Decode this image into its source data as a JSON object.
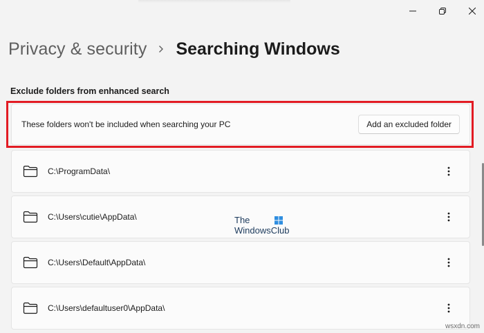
{
  "breadcrumb": {
    "parent": "Privacy & security",
    "current": "Searching Windows"
  },
  "section": {
    "heading": "Exclude folders from enhanced search"
  },
  "header_card": {
    "description": "These folders won't be included when searching your PC",
    "add_button": "Add an excluded folder"
  },
  "folders": [
    {
      "path": "C:\\ProgramData\\"
    },
    {
      "path": "C:\\Users\\cutie\\AppData\\"
    },
    {
      "path": "C:\\Users\\Default\\AppData\\"
    },
    {
      "path": "C:\\Users\\defaultuser0\\AppData\\"
    }
  ],
  "watermark": {
    "line1": "The",
    "line2": "WindowsClub"
  },
  "site_mark": "wsxdn.com",
  "colors": {
    "highlight": "#e21b23",
    "background": "#f3f3f3",
    "card": "#fbfbfb"
  },
  "icons": {
    "window": [
      "minimize-icon",
      "maximize-icon",
      "close-icon"
    ],
    "breadcrumb_separator": "chevron-right-icon",
    "folder": "folder-icon",
    "row_menu": "more-vertical-icon"
  }
}
